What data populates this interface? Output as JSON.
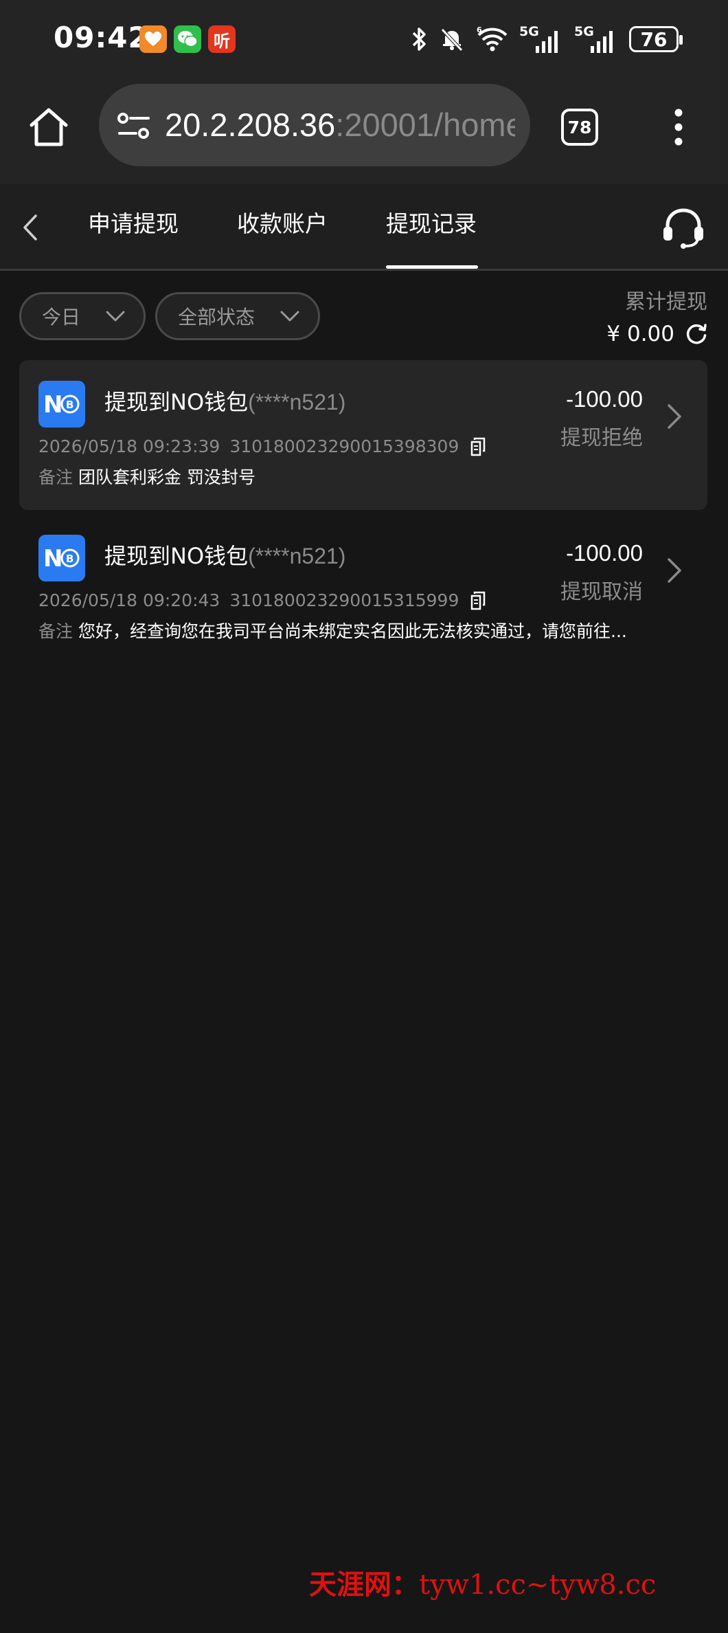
{
  "status_bar": {
    "time": "09:42",
    "app_badges": [
      "heart-app-icon",
      "wechat-icon",
      "listen-app-icon"
    ],
    "listen_badge_text": "听",
    "network_labels": [
      "5G",
      "5G"
    ],
    "battery": "76"
  },
  "browser": {
    "url_host": "20.2.208.36",
    "url_rest": ":20001/home",
    "tab_count": "78"
  },
  "nav": {
    "tabs": [
      {
        "label": "申请提现"
      },
      {
        "label": "收款账户"
      },
      {
        "label": "提现记录",
        "active": true
      }
    ]
  },
  "filters": {
    "date": "今日",
    "status": "全部状态"
  },
  "summary": {
    "label": "累计提现",
    "amount": "¥ 0.00"
  },
  "records": [
    {
      "destination": "提现到NO钱包",
      "account": "(****n521)",
      "datetime": "2026/05/18 09:23:39",
      "id": "310180023290015398309",
      "note_label": "备注",
      "note": "团队套利彩金 罚没封号",
      "amount": "-100.00",
      "status": "提现拒绝"
    },
    {
      "destination": "提现到NO钱包",
      "account": "(****n521)",
      "datetime": "2026/05/18 09:20:43",
      "id": "310180023290015315999",
      "note_label": "备注",
      "note": "您好，经查询您在我司平台尚未绑定实名因此无法核实通过，请您前往...",
      "amount": "-100.00",
      "status": "提现取消"
    }
  ],
  "watermark": {
    "cn": "天涯网：",
    "url": "tyw1.cc~tyw8.cc"
  },
  "colors": {
    "background": "#161616",
    "card": "#262626",
    "wallet_brand": "#2a7bf2",
    "watermark": "#e01010"
  }
}
